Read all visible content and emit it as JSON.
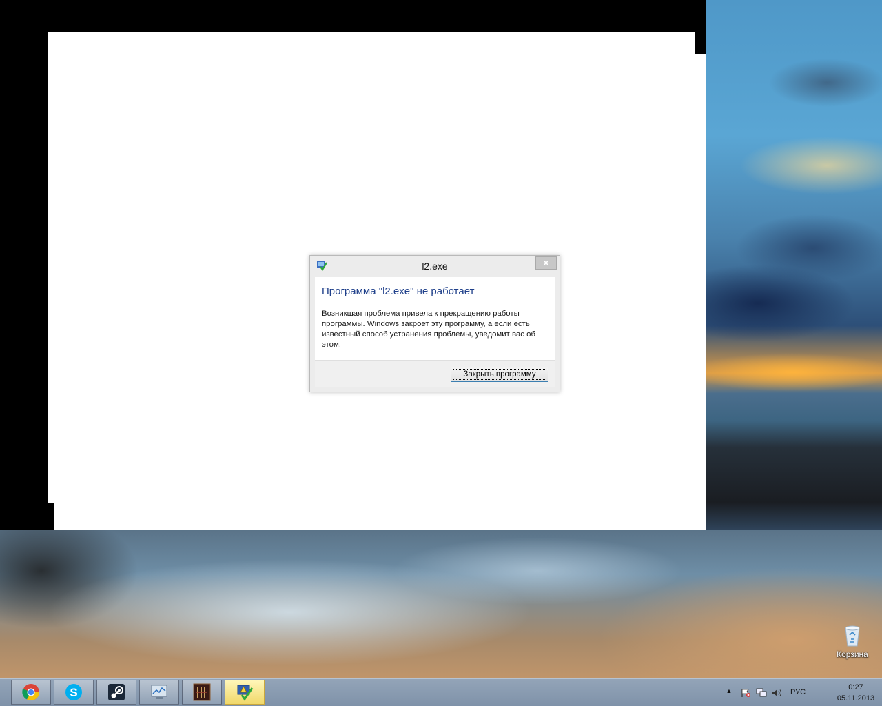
{
  "dialog": {
    "title": "l2.exe",
    "heading": "Программа \"l2.exe\" не работает",
    "message": "Возникшая проблема привела к прекращению работы программы. Windows закроет эту программу, а если есть известный способ устранения проблемы, уведомит вас об этом.",
    "close_button_label": "Закрыть программу",
    "close_glyph": "×"
  },
  "desktop": {
    "icons": [
      {
        "label": "Корзина",
        "icon": "recycle-bin-icon"
      }
    ]
  },
  "taskbar": {
    "buttons": [
      {
        "icon": "chrome-icon",
        "active": false
      },
      {
        "icon": "skype-icon",
        "active": false
      },
      {
        "icon": "steam-icon",
        "active": false
      },
      {
        "icon": "monitor-icon",
        "active": false
      },
      {
        "icon": "lineage-icon",
        "active": false
      },
      {
        "icon": "problem-reporting-icon",
        "active": true
      }
    ],
    "tray": {
      "show_hidden_glyph": "▲",
      "language": "РУС",
      "time": "0:27",
      "date": "05.11.2013"
    }
  },
  "colors": {
    "heading_blue": "#1e3f8a",
    "active_taskbar_button": "#f0d86a"
  }
}
